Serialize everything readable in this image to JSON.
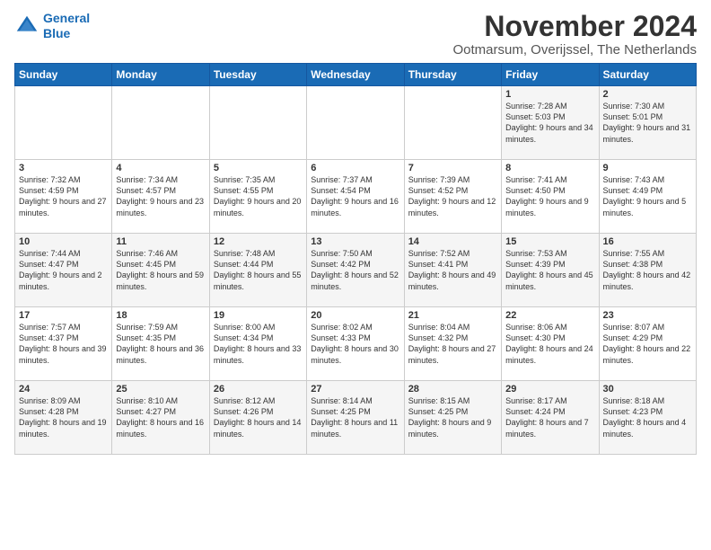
{
  "logo": {
    "line1": "General",
    "line2": "Blue"
  },
  "title": "November 2024",
  "subtitle": "Ootmarsum, Overijssel, The Netherlands",
  "weekdays": [
    "Sunday",
    "Monday",
    "Tuesday",
    "Wednesday",
    "Thursday",
    "Friday",
    "Saturday"
  ],
  "weeks": [
    [
      {
        "day": "",
        "info": ""
      },
      {
        "day": "",
        "info": ""
      },
      {
        "day": "",
        "info": ""
      },
      {
        "day": "",
        "info": ""
      },
      {
        "day": "",
        "info": ""
      },
      {
        "day": "1",
        "info": "Sunrise: 7:28 AM\nSunset: 5:03 PM\nDaylight: 9 hours and 34 minutes."
      },
      {
        "day": "2",
        "info": "Sunrise: 7:30 AM\nSunset: 5:01 PM\nDaylight: 9 hours and 31 minutes."
      }
    ],
    [
      {
        "day": "3",
        "info": "Sunrise: 7:32 AM\nSunset: 4:59 PM\nDaylight: 9 hours and 27 minutes."
      },
      {
        "day": "4",
        "info": "Sunrise: 7:34 AM\nSunset: 4:57 PM\nDaylight: 9 hours and 23 minutes."
      },
      {
        "day": "5",
        "info": "Sunrise: 7:35 AM\nSunset: 4:55 PM\nDaylight: 9 hours and 20 minutes."
      },
      {
        "day": "6",
        "info": "Sunrise: 7:37 AM\nSunset: 4:54 PM\nDaylight: 9 hours and 16 minutes."
      },
      {
        "day": "7",
        "info": "Sunrise: 7:39 AM\nSunset: 4:52 PM\nDaylight: 9 hours and 12 minutes."
      },
      {
        "day": "8",
        "info": "Sunrise: 7:41 AM\nSunset: 4:50 PM\nDaylight: 9 hours and 9 minutes."
      },
      {
        "day": "9",
        "info": "Sunrise: 7:43 AM\nSunset: 4:49 PM\nDaylight: 9 hours and 5 minutes."
      }
    ],
    [
      {
        "day": "10",
        "info": "Sunrise: 7:44 AM\nSunset: 4:47 PM\nDaylight: 9 hours and 2 minutes."
      },
      {
        "day": "11",
        "info": "Sunrise: 7:46 AM\nSunset: 4:45 PM\nDaylight: 8 hours and 59 minutes."
      },
      {
        "day": "12",
        "info": "Sunrise: 7:48 AM\nSunset: 4:44 PM\nDaylight: 8 hours and 55 minutes."
      },
      {
        "day": "13",
        "info": "Sunrise: 7:50 AM\nSunset: 4:42 PM\nDaylight: 8 hours and 52 minutes."
      },
      {
        "day": "14",
        "info": "Sunrise: 7:52 AM\nSunset: 4:41 PM\nDaylight: 8 hours and 49 minutes."
      },
      {
        "day": "15",
        "info": "Sunrise: 7:53 AM\nSunset: 4:39 PM\nDaylight: 8 hours and 45 minutes."
      },
      {
        "day": "16",
        "info": "Sunrise: 7:55 AM\nSunset: 4:38 PM\nDaylight: 8 hours and 42 minutes."
      }
    ],
    [
      {
        "day": "17",
        "info": "Sunrise: 7:57 AM\nSunset: 4:37 PM\nDaylight: 8 hours and 39 minutes."
      },
      {
        "day": "18",
        "info": "Sunrise: 7:59 AM\nSunset: 4:35 PM\nDaylight: 8 hours and 36 minutes."
      },
      {
        "day": "19",
        "info": "Sunrise: 8:00 AM\nSunset: 4:34 PM\nDaylight: 8 hours and 33 minutes."
      },
      {
        "day": "20",
        "info": "Sunrise: 8:02 AM\nSunset: 4:33 PM\nDaylight: 8 hours and 30 minutes."
      },
      {
        "day": "21",
        "info": "Sunrise: 8:04 AM\nSunset: 4:32 PM\nDaylight: 8 hours and 27 minutes."
      },
      {
        "day": "22",
        "info": "Sunrise: 8:06 AM\nSunset: 4:30 PM\nDaylight: 8 hours and 24 minutes."
      },
      {
        "day": "23",
        "info": "Sunrise: 8:07 AM\nSunset: 4:29 PM\nDaylight: 8 hours and 22 minutes."
      }
    ],
    [
      {
        "day": "24",
        "info": "Sunrise: 8:09 AM\nSunset: 4:28 PM\nDaylight: 8 hours and 19 minutes."
      },
      {
        "day": "25",
        "info": "Sunrise: 8:10 AM\nSunset: 4:27 PM\nDaylight: 8 hours and 16 minutes."
      },
      {
        "day": "26",
        "info": "Sunrise: 8:12 AM\nSunset: 4:26 PM\nDaylight: 8 hours and 14 minutes."
      },
      {
        "day": "27",
        "info": "Sunrise: 8:14 AM\nSunset: 4:25 PM\nDaylight: 8 hours and 11 minutes."
      },
      {
        "day": "28",
        "info": "Sunrise: 8:15 AM\nSunset: 4:25 PM\nDaylight: 8 hours and 9 minutes."
      },
      {
        "day": "29",
        "info": "Sunrise: 8:17 AM\nSunset: 4:24 PM\nDaylight: 8 hours and 7 minutes."
      },
      {
        "day": "30",
        "info": "Sunrise: 8:18 AM\nSunset: 4:23 PM\nDaylight: 8 hours and 4 minutes."
      }
    ]
  ]
}
